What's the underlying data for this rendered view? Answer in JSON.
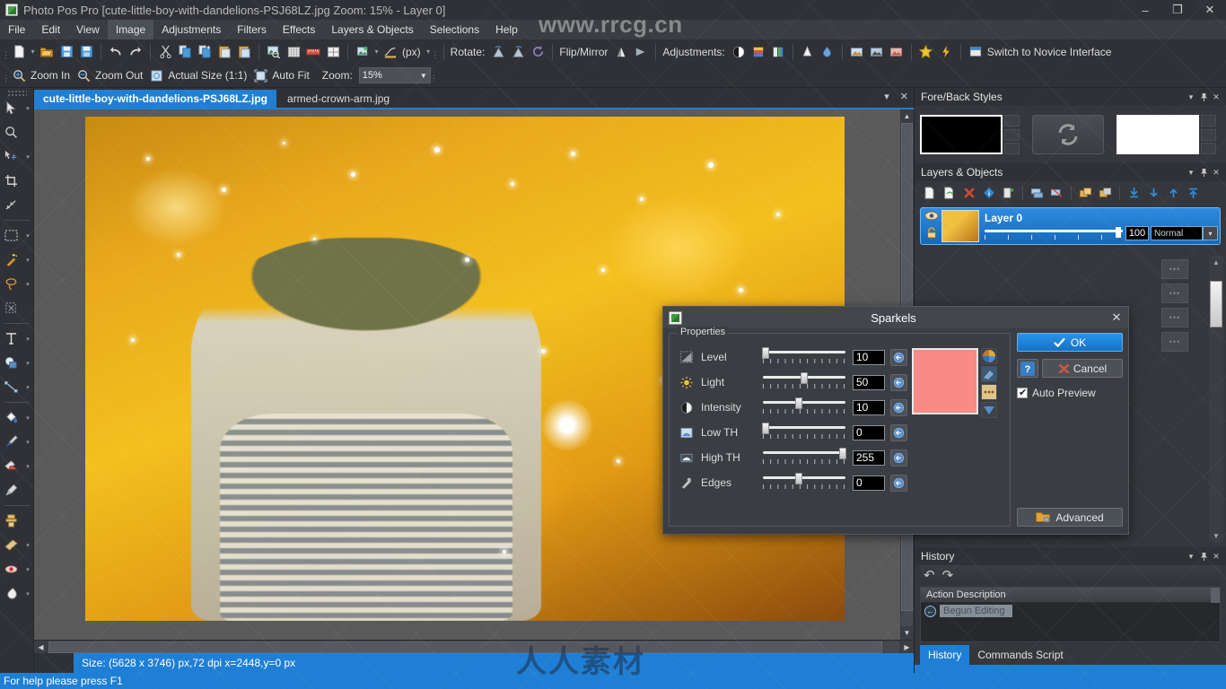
{
  "window": {
    "title": "Photo Pos Pro [cute-little-boy-with-dandelions-PSJ68LZ.jpg Zoom: 15% - Layer 0]",
    "app_icon": "photo-pos-pro-icon",
    "minimize": "–",
    "restore": "❐",
    "close": "✕"
  },
  "menubar": {
    "items": [
      {
        "label": "File"
      },
      {
        "label": "Edit"
      },
      {
        "label": "View"
      },
      {
        "label": "Image",
        "active": true
      },
      {
        "label": "Adjustments"
      },
      {
        "label": "Filters"
      },
      {
        "label": "Effects"
      },
      {
        "label": "Layers & Objects"
      },
      {
        "label": "Selections"
      },
      {
        "label": "Help"
      }
    ]
  },
  "toolbar_main": {
    "rotate_label": "Rotate:",
    "flipmirror_label": "Flip/Mirror",
    "adjustments_label": "Adjustments:",
    "units_label": "(px)",
    "switch_interface_label": "Switch to Novice Interface",
    "icons": [
      "new-file-icon",
      "open-file-icon",
      "save-icon",
      "save-as-icon",
      "undo-icon",
      "redo-icon",
      "cut-icon",
      "copy-icon",
      "copy-merged-icon",
      "paste-icon",
      "paste-into-icon",
      "print-preview-icon",
      "grid-icon",
      "ruler-icon",
      "layout-icon",
      "image-resize-icon",
      "curve-icon",
      "rotate-left-icon",
      "rotate-right-icon",
      "rotate-free-icon",
      "flip-horizontal-icon",
      "flip-vertical-icon",
      "brightness-icon",
      "levels-icon",
      "color-balance-icon",
      "white-balance-icon",
      "hue-icon",
      "auto-contrast-icon",
      "auto-levels-icon",
      "auto-color-icon",
      "favorites-icon",
      "quick-fix-icon"
    ]
  },
  "toolbar_zoom": {
    "zoom_in_label": "Zoom In",
    "zoom_out_label": "Zoom Out",
    "actual_size_label": "Actual Size (1:1)",
    "auto_fit_label": "Auto Fit",
    "zoom_label": "Zoom:",
    "zoom_value": "15%"
  },
  "tools_panel": {
    "items": [
      {
        "name": "move-tool",
        "glyph": "arrow"
      },
      {
        "name": "zoom-tool",
        "glyph": "magnifier"
      },
      {
        "name": "pan-tool",
        "glyph": "hand-move"
      },
      {
        "name": "crop-tool",
        "glyph": "crop"
      },
      {
        "name": "measure-tool",
        "glyph": "measure"
      },
      {
        "name": "rectangular-select-tool",
        "glyph": "marquee"
      },
      {
        "name": "magic-wand-tool",
        "glyph": "wand"
      },
      {
        "name": "lasso-tool",
        "glyph": "lasso"
      },
      {
        "name": "transform-tool",
        "glyph": "transform"
      },
      {
        "name": "text-tool",
        "glyph": "T"
      },
      {
        "name": "shape-tool",
        "glyph": "shape"
      },
      {
        "name": "line-tool",
        "glyph": "line"
      },
      {
        "name": "paint-bucket-tool",
        "glyph": "bucket"
      },
      {
        "name": "brush-tool",
        "glyph": "brush"
      },
      {
        "name": "eraser-tool",
        "glyph": "eraser"
      },
      {
        "name": "eyedropper-tool",
        "glyph": "eyedropper"
      },
      {
        "name": "clone-stamp-tool",
        "glyph": "stamp"
      },
      {
        "name": "blur-sharpen-tool",
        "glyph": "blur"
      },
      {
        "name": "red-eye-tool",
        "glyph": "redeye"
      },
      {
        "name": "smudge-tool",
        "glyph": "smudge"
      }
    ]
  },
  "documents": {
    "tabs": [
      {
        "label": "cute-little-boy-with-dandelions-PSJ68LZ.jpg",
        "active": true
      },
      {
        "label": "armed-crown-arm.jpg",
        "active": false
      }
    ],
    "menu_glyph": "▾",
    "close_glyph": "✕"
  },
  "info_bar": {
    "text": "Size: (5628 x 3746) px,72 dpi   x=2448,y=0 px"
  },
  "status_bar": {
    "text": "For help please press F1"
  },
  "dock": {
    "fore_back": {
      "title": "Fore/Back Styles",
      "foreground_color": "#000000",
      "background_color": "#ffffff",
      "swap_icon": "swap-colors-icon",
      "collapse_glyph": "▾",
      "pin_glyph": "📌",
      "close_glyph": "✕"
    },
    "layers": {
      "title": "Layers & Objects",
      "tools": [
        "new-layer-icon",
        "duplicate-layer-icon",
        "delete-layer-icon",
        "layer-properties-icon",
        "new-from-selection-icon",
        "merge-down-icon",
        "flatten-icon",
        "group-layers-icon",
        "ungroup-layers-icon",
        "move-to-bottom-icon",
        "move-down-icon",
        "move-up-icon",
        "move-to-top-icon"
      ],
      "items": [
        {
          "name": "Layer 0",
          "opacity": "100",
          "blend_mode": "Normal",
          "visible_icon": "eye-icon",
          "lock_icon": "lock-icon",
          "dropdown_glyph": "▾"
        }
      ]
    },
    "history": {
      "title": "History",
      "undo_glyph": "↶",
      "redo_glyph": "↷",
      "column_header": "Action Description",
      "rows": [
        {
          "label": "Begun Editing",
          "marker": "←"
        }
      ],
      "tabs": [
        {
          "label": "History",
          "active": true
        },
        {
          "label": "Commands Script",
          "active": false
        }
      ]
    }
  },
  "dialog": {
    "title": "Sparkels",
    "icon": "sparkels-icon",
    "close_glyph": "✕",
    "group_legend": "Properties",
    "properties": [
      {
        "label": "Level",
        "value": "10",
        "icon": "level-icon",
        "pos": 3
      },
      {
        "label": "Light",
        "value": "50",
        "icon": "light-icon",
        "pos": 50
      },
      {
        "label": "Intensity",
        "value": "10",
        "icon": "intensity-icon",
        "pos": 44
      },
      {
        "label": "Low TH",
        "value": "0",
        "icon": "low-th-icon",
        "pos": 3
      },
      {
        "label": "High TH",
        "value": "255",
        "icon": "high-th-icon",
        "pos": 96
      },
      {
        "label": "Edges",
        "value": "0",
        "icon": "edges-icon",
        "pos": 44
      }
    ],
    "reset_icon": "reset-icon",
    "preview_color": "#f98a85",
    "preview_side_buttons": [
      "color-wheel-icon",
      "gradient-icon",
      "pattern-icon",
      "fill-down-icon"
    ],
    "ok_label": "OK",
    "cancel_label": "Cancel",
    "help_label": "?",
    "auto_preview_label": "Auto Preview",
    "auto_preview_checked": true,
    "advanced_label": "Advanced"
  },
  "watermarks": {
    "url": "www.rrcg.cn",
    "site": "人人素材"
  }
}
